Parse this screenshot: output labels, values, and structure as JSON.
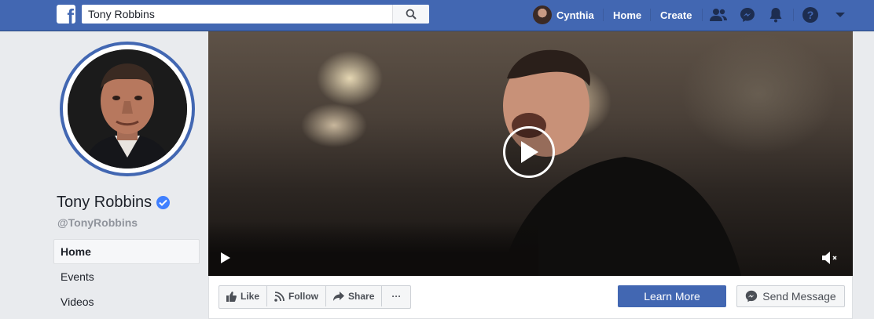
{
  "colors": {
    "brand": "#4267b2",
    "verified": "#4080ff"
  },
  "topbar": {
    "logo": "f",
    "search_value": "Tony Robbins",
    "user_name": "Cynthia",
    "home_label": "Home",
    "create_label": "Create",
    "icons": [
      "friends-icon",
      "messenger-icon",
      "notifications-icon",
      "help-icon",
      "account-menu-icon"
    ]
  },
  "profile": {
    "name": "Tony Robbins",
    "handle": "@TonyRobbins"
  },
  "sidebar": {
    "items": [
      {
        "label": "Home"
      },
      {
        "label": "Events"
      },
      {
        "label": "Videos"
      }
    ]
  },
  "actions": {
    "like": "Like",
    "follow": "Follow",
    "share": "Share",
    "more": "···",
    "learn_more": "Learn More",
    "send_message": "Send Message"
  }
}
